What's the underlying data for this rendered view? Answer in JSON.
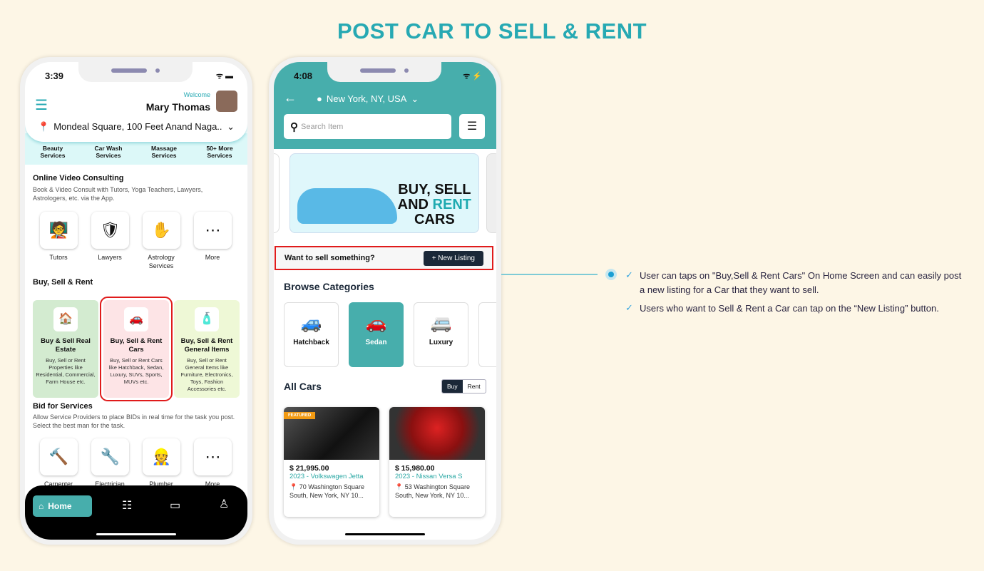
{
  "title": "POST CAR TO SELL & RENT",
  "phone1": {
    "time": "3:39",
    "welcome": "Welcome",
    "user_name": "Mary Thomas",
    "location": "Mondeal Square, 100 Feet Anand Naga...",
    "services": [
      "Beauty Services",
      "Car Wash Services",
      "Massage Services",
      "50+ More Services"
    ],
    "consult": {
      "heading": "Online Video Consulting",
      "desc": "Book & Video Consult with Tutors, Yoga Teachers, Lawyers, Astrologers, etc. via the App.",
      "items": [
        "Tutors",
        "Lawyers",
        "Astrology Services",
        "More"
      ]
    },
    "bsr": {
      "heading": "Buy, Sell & Rent",
      "cards": [
        {
          "title": "Buy & Sell Real Estate",
          "desc": "Buy, Sell or Rent Properties like Residential, Commercial, Farm House etc.",
          "color": "#d3ebd0"
        },
        {
          "title": "Buy, Sell & Rent Cars",
          "desc": "Buy, Sell or Rent Cars like Hatchback, Sedan, Luxury, SUVs, Sports, MUVs  etc.",
          "color": "#fde4e6"
        },
        {
          "title": "Buy, Sell & Rent General Items",
          "desc": "Buy, Sell or Rent General Items like Furniture, Electronics, Toys, Fashion Accessories  etc.",
          "color": "#eef8d6"
        }
      ]
    },
    "bid": {
      "heading": "Bid for Services",
      "desc": "Allow Service Providers to place BIDs in real time for the task you post. Select the best man for the task.",
      "items": [
        "Carpenter",
        "Electrician",
        "Plumber",
        "More"
      ]
    },
    "nav": {
      "home": "Home"
    }
  },
  "phone2": {
    "time": "4:08",
    "location": "New York, NY, USA",
    "search_placeholder": "Search Item",
    "banner": {
      "line1": "BUY, SELL",
      "line2a": "AND ",
      "line2b": "RENT",
      "line3": "CARS"
    },
    "sell_prompt": "Want to sell something?",
    "new_listing": "+ New Listing",
    "browse_heading": "Browse Categories",
    "categories": [
      "Hatchback",
      "Sedan",
      "Luxury"
    ],
    "all_cars": "All Cars",
    "toggle": [
      "Buy",
      "Rent"
    ],
    "cars": [
      {
        "badge": "FEATURED",
        "price": "$ 21,995.00",
        "name": "2023 - Volkswagen Jetta",
        "address": "70 Washington Square South, New York, NY 10..."
      },
      {
        "price": "$ 15,980.00",
        "name": "2023 - Nissan Versa S",
        "address": "53 Washington Square South, New York, NY 10..."
      }
    ]
  },
  "notes": [
    "User can taps on \"Buy,Sell & Rent Cars\" On Home Screen and can easily post a new listing for a Car that they want to sell.",
    "Users who want to Sell & Rent a Car can tap on the “New Listing” button."
  ],
  "colors": {
    "accent": "#27a9b3",
    "teal": "#47aeac",
    "highlight": "#e01b1b",
    "dark": "#1b2838"
  }
}
